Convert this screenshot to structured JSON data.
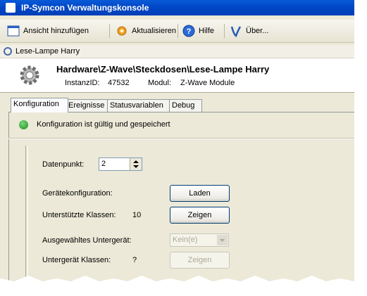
{
  "window": {
    "title": "IP-Symcon Verwaltungskonsole"
  },
  "toolbar": {
    "add_view": "Ansicht hinzufügen",
    "refresh": "Aktualisieren",
    "help": "Hilfe",
    "about": "Über..."
  },
  "breadcrumb": {
    "label": "Lese-Lampe Harry"
  },
  "header": {
    "path": "Hardware\\Z-Wave\\Steckdosen\\Lese-Lampe Harry",
    "instance_label": "InstanzID:",
    "instance_id": "47532",
    "module_label": "Modul:",
    "module_name": "Z-Wave Module"
  },
  "tabs": [
    "Konfiguration",
    "Ereignisse",
    "Statusvariablen",
    "Debug"
  ],
  "status": {
    "message": "Konfiguration ist gültig und gespeichert"
  },
  "form": {
    "datapoint_label": "Datenpunkt:",
    "datapoint_value": "2",
    "device_config_label": "Gerätekonfiguration:",
    "load_button": "Laden",
    "classes_label": "Unterstützte Klassen:",
    "classes_count": "10",
    "show_button": "Zeigen",
    "subdevice_label": "Ausgewähltes Untergerät:",
    "subdevice_value": "Kein(e)",
    "subdevice_classes_label": "Untergerät Klassen:",
    "subdevice_classes_value": "?",
    "show_button_2": "Zeigen"
  },
  "colors": {
    "titlebar": "#0047c6",
    "window_bg": "#ece9d8",
    "ok": "#1d8a1d"
  }
}
